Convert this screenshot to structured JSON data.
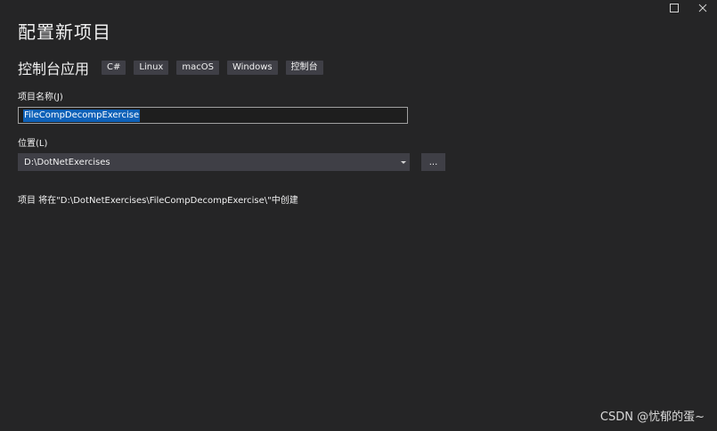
{
  "window": {
    "maximize_icon": "maximize-square-icon",
    "close_icon": "close-x-icon"
  },
  "page_title": "配置新项目",
  "template": {
    "name": "控制台应用",
    "tags": [
      "C#",
      "Linux",
      "macOS",
      "Windows",
      "控制台"
    ]
  },
  "project_name": {
    "label": "项目名称(J)",
    "value": "FileCompDecompExercise"
  },
  "location": {
    "label": "位置(L)",
    "value": "D:\\DotNetExercises",
    "browse_label": "..."
  },
  "create_info": "项目 将在\"D:\\DotNetExercises\\FileCompDecompExercise\\\"中创建",
  "watermark": "CSDN @忧郁的蛋~",
  "colors": {
    "background": "#252526",
    "tag_bg": "#3f3f46",
    "selection": "#0e61b8"
  }
}
